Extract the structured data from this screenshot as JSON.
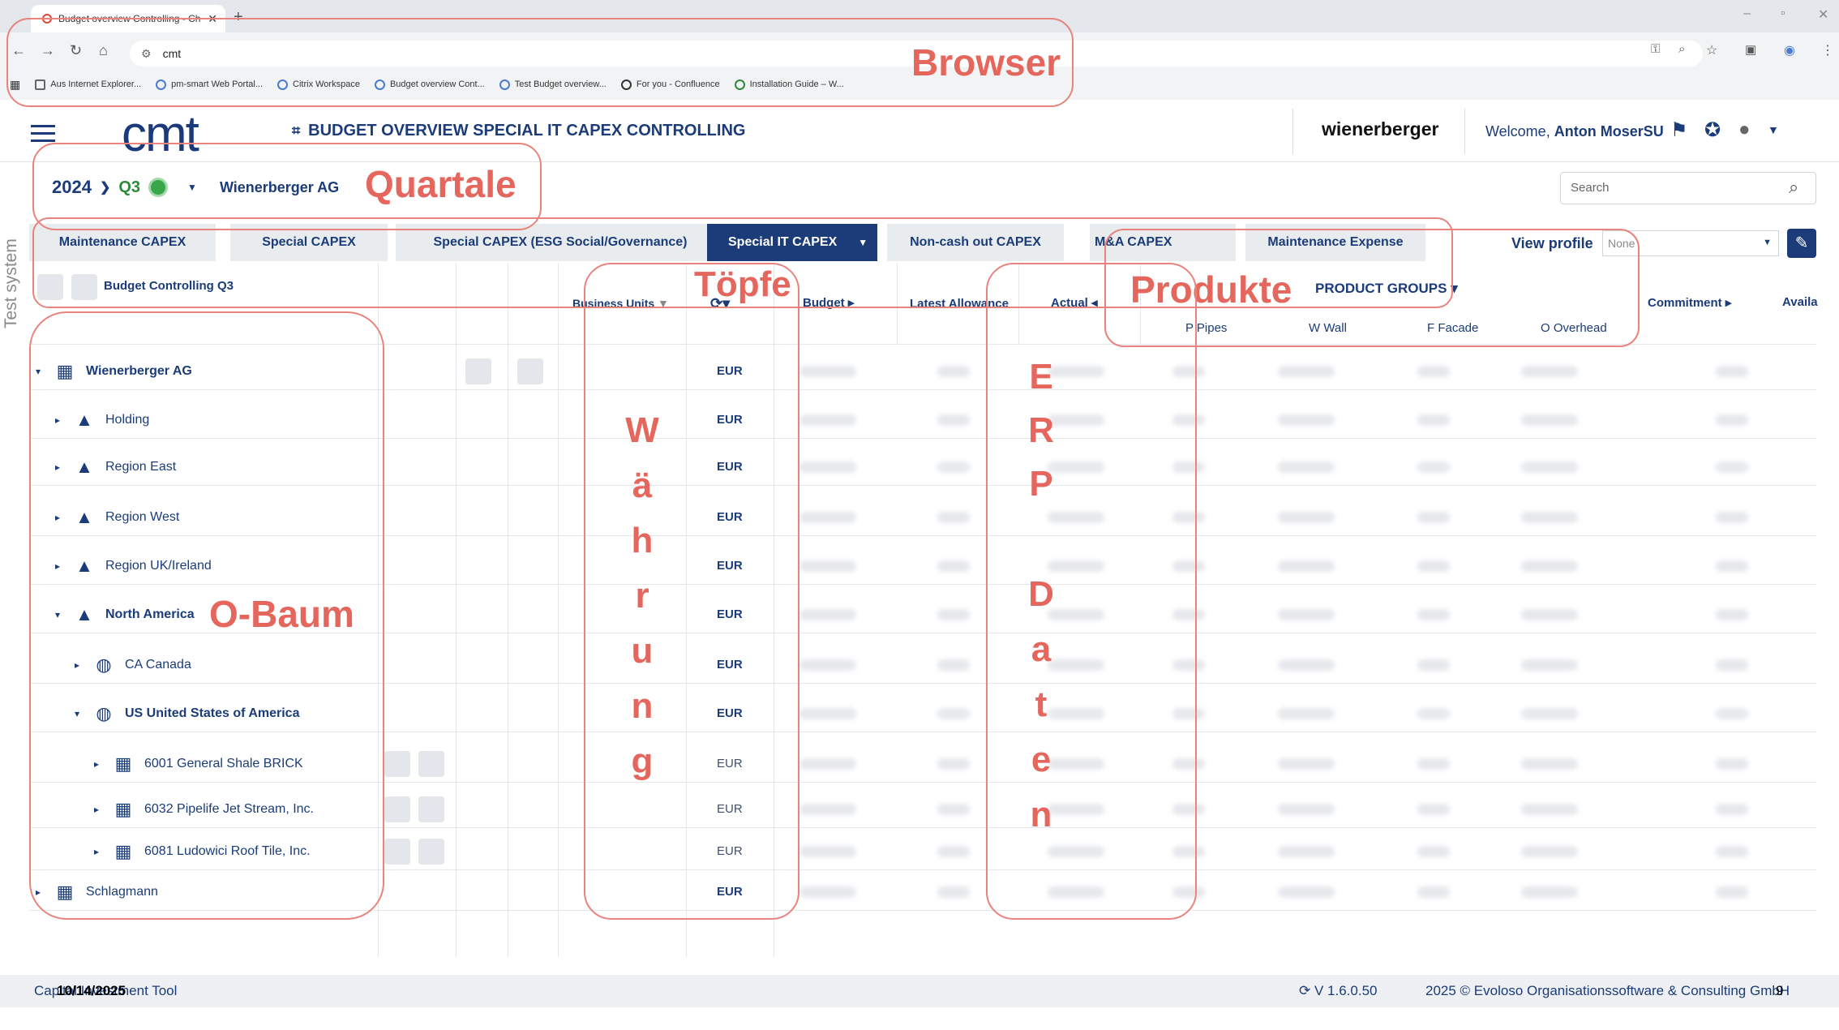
{
  "browser": {
    "tab_title": "Budget overview Controlling - Ch",
    "url": "cmt",
    "bookmarks": [
      "Aus Internet Explorer...",
      "pm-smart Web Portal...",
      "Citrix Workspace",
      "Budget overview Cont...",
      "Test Budget overview...",
      "For you - Confluence",
      "Installation Guide – W..."
    ]
  },
  "app": {
    "logo": "cmt",
    "title": "BUDGET OVERVIEW SPECIAL IT CAPEX CONTROLLING",
    "brand": "wienerberger",
    "welcome_prefix": "Welcome,",
    "user": "Anton MoserSU",
    "side_label": "Test system"
  },
  "period": {
    "year": "2024",
    "quarter": "Q3",
    "company": "Wienerberger AG"
  },
  "search": {
    "placeholder": "Search"
  },
  "tabs": [
    {
      "label": "Maintenance CAPEX"
    },
    {
      "label": "Special CAPEX"
    },
    {
      "label": "Special CAPEX (ESG Social/Governance)"
    },
    {
      "label": "Special IT CAPEX"
    },
    {
      "label": "Non-cash out CAPEX"
    },
    {
      "label": "M&A CAPEX"
    },
    {
      "label": "Maintenance Expense"
    }
  ],
  "view_profile": {
    "label": "View profile",
    "value": "None"
  },
  "grid": {
    "title": "Budget Controlling Q3",
    "headers": {
      "business_units": "Business Units",
      "budget": "Budget",
      "latest_allowance": "Latest Allowance",
      "actual": "Actual",
      "product_groups": "PRODUCT GROUPS",
      "commitment": "Commitment",
      "available": "Availa"
    },
    "product_cols": [
      "P Pipes",
      "W Wall",
      "F Facade",
      "O Overhead"
    ],
    "rows": [
      {
        "name": "Wienerberger AG",
        "currency": "EUR"
      },
      {
        "name": "Holding",
        "currency": "EUR"
      },
      {
        "name": "Region East",
        "currency": "EUR"
      },
      {
        "name": "Region West",
        "currency": "EUR"
      },
      {
        "name": "Region UK/Ireland",
        "currency": "EUR"
      },
      {
        "name": "North America",
        "currency": "EUR"
      },
      {
        "name": "CA Canada",
        "currency": "EUR"
      },
      {
        "name": "US United States of America",
        "currency": "EUR"
      },
      {
        "name": "6001 General Shale BRICK",
        "currency": "EUR"
      },
      {
        "name": "6032 Pipelife Jet Stream, Inc.",
        "currency": "EUR"
      },
      {
        "name": "6081 Ludowici Roof Tile, Inc.",
        "currency": "EUR"
      },
      {
        "name": "Schlagmann",
        "currency": "EUR"
      }
    ]
  },
  "annotations": {
    "browser": "Browser",
    "quartale": "Quartale",
    "toepfe": "Töpfe",
    "produkte": "Produkte",
    "obaum": "O-Baum",
    "waehrung": [
      "W",
      "ä",
      "h",
      "r",
      "u",
      "n",
      "g"
    ],
    "erp": [
      "E",
      "R",
      "P"
    ],
    "daten": [
      "D",
      "a",
      "t",
      "e",
      "n"
    ]
  },
  "footer": {
    "left": "Capital Investment Tool",
    "date": "10/14/2025",
    "version": "V 1.6.0.50",
    "copyright": "2025 © Evoloso Organisationssoftware & Consulting GmbH",
    "page": "9"
  },
  "colors": {
    "primary": "#1b3c78",
    "accent": "#e1453a",
    "annotation": "#e4665d",
    "ok": "#3aa64a"
  }
}
